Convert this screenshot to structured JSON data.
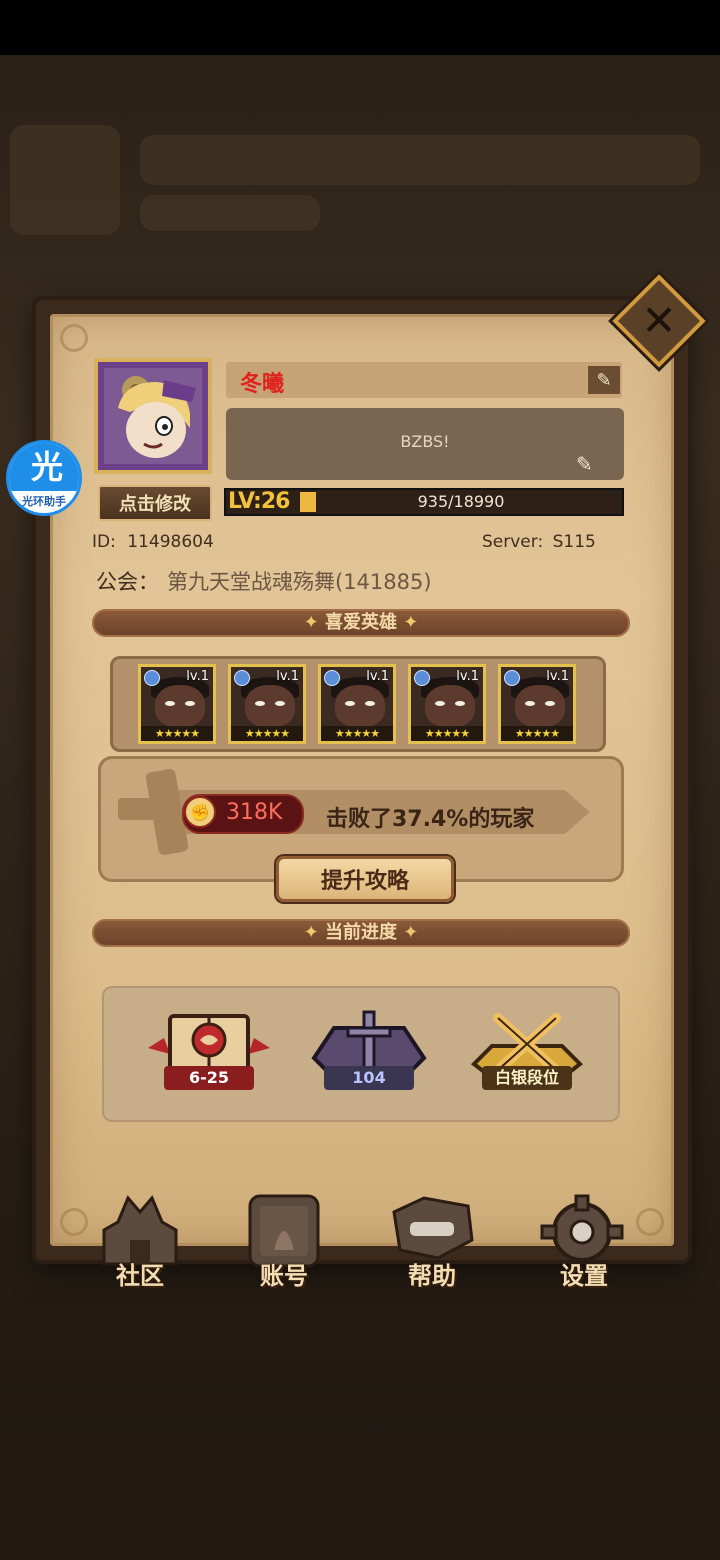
{
  "profile": {
    "name": "冬曦",
    "signature": "BZBS!",
    "edit_avatar_label": "点击修改",
    "level_label": "LV:26",
    "exp_text": "935/18990",
    "exp_fraction": 0.049,
    "id_label": "ID:",
    "id_value": "11498604",
    "server_label": "Server:",
    "server_value": "S115",
    "guild_label": "公会：",
    "guild_value": "第九天堂战魂殇舞(141885)"
  },
  "favorite_heroes": {
    "title": "喜爱英雄",
    "heroes": [
      {
        "level": "lv.1",
        "stars": "★★★★★"
      },
      {
        "level": "lv.1",
        "stars": "★★★★★"
      },
      {
        "level": "lv.1",
        "stars": "★★★★★"
      },
      {
        "level": "lv.1",
        "stars": "★★★★★"
      },
      {
        "level": "lv.1",
        "stars": "★★★★★"
      }
    ],
    "power_value": "318K",
    "defeat_text": "击败了37.4%的玩家",
    "strategy_button": "提升攻略"
  },
  "progress": {
    "title": "当前进度",
    "stage": "6-25",
    "tower": "104",
    "arena_rank": "白银段位"
  },
  "nav": {
    "community": "社区",
    "account": "账号",
    "help": "帮助",
    "settings": "设置"
  },
  "helper": {
    "glyph": "光",
    "label": "光环助手"
  },
  "icons": {
    "close": "close-icon",
    "edit": "pencil-icon"
  }
}
